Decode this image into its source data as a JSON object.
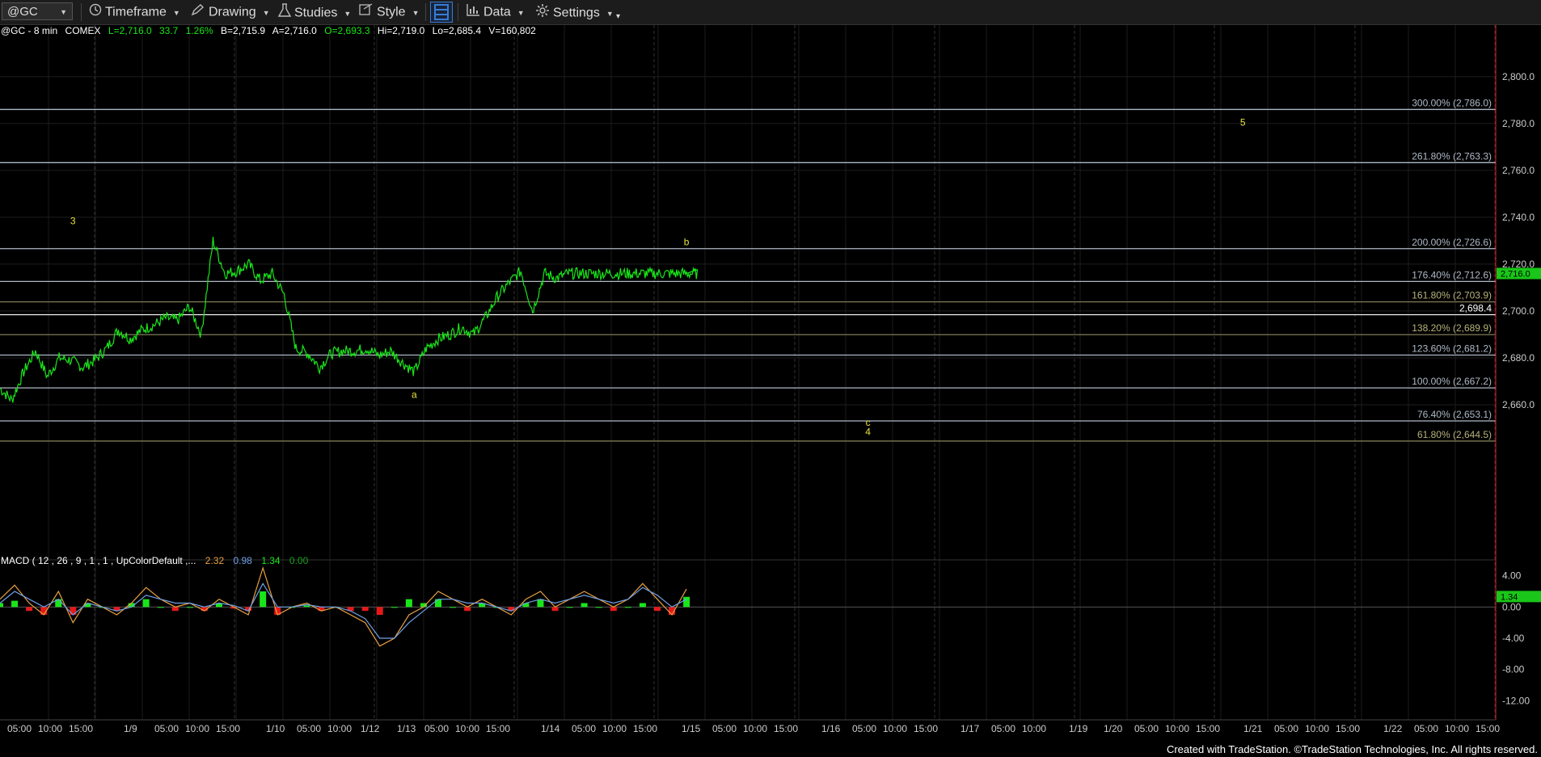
{
  "toolbar": {
    "symbol": "@GC",
    "timeframe": "Timeframe",
    "drawing": "Drawing",
    "studies": "Studies",
    "style": "Style",
    "data": "Data",
    "settings": "Settings",
    "icons": [
      "clock-icon",
      "pencil-icon",
      "flask-icon",
      "style-icon",
      "layout-icon",
      "bar-chart-icon",
      "gear-icon"
    ]
  },
  "quote_line": {
    "name": "@GC - 8 min",
    "exchange": "COMEX",
    "last": "L=2,716.0",
    "change": "33.7",
    "pct": "1.26%",
    "bid": "B=2,715.9",
    "ask": "A=2,716.0",
    "open": "O=2,693.3",
    "high": "Hi=2,719.0",
    "low": "Lo=2,685.4",
    "volume": "V=160,802"
  },
  "colors": {
    "price": "#19e619",
    "fib_line": "#aeb9c6",
    "fib_line_alt": "#7d7a55",
    "wave_label": "#e8e23c",
    "macd_line": "#e8a040",
    "signal_line": "#6fa0e8",
    "hist_pos": "#19e619",
    "hist_neg": "#e61919",
    "last_price_tag": "#19c619"
  },
  "footer": "Created with TradeStation. ©TradeStation Technologies, Inc. All rights reserved.",
  "chart_data": [
    {
      "type": "line",
      "title": "",
      "series": [
        {
          "name": "@GC - 8 min",
          "x_index": [
            0,
            3,
            6,
            9,
            12,
            15,
            18,
            21,
            24,
            27,
            30,
            33,
            36,
            39,
            42,
            45,
            48,
            51,
            54,
            57,
            60,
            63,
            66,
            69,
            72,
            75,
            78,
            81,
            84,
            87,
            90,
            93,
            96,
            99,
            102,
            105,
            108,
            111,
            114,
            117,
            120,
            123,
            126,
            129,
            132,
            135,
            138,
            141,
            144,
            147,
            150,
            153,
            156,
            159,
            162,
            165,
            168,
            171,
            174,
            177,
            180,
            183,
            186,
            189,
            192,
            195
          ],
          "values": [
            2667,
            2662,
            2674,
            2683,
            2672,
            2680,
            2679,
            2676,
            2679,
            2684,
            2692,
            2688,
            2692,
            2694,
            2697,
            2696,
            2702,
            2690,
            2730,
            2716,
            2717,
            2720,
            2713,
            2716,
            2707,
            2684,
            2682,
            2676,
            2682,
            2683,
            2683,
            2684,
            2681,
            2683,
            2678,
            2674,
            2684,
            2688,
            2690,
            2693,
            2690,
            2697,
            2706,
            2712,
            2717,
            2700,
            2716,
            2714,
            2716,
            2716,
            2716,
            2716,
            2716,
            2716,
            2716,
            2716,
            2716,
            2716,
            2716,
            2716,
            2716,
            2716,
            2716,
            2716,
            2716,
            2716
          ]
        }
      ],
      "x_tick_labels": [
        "05:00",
        "10:00",
        "15:00",
        "1/9",
        "05:00",
        "10:00",
        "15:00",
        "1/10",
        "05:00",
        "10:00",
        "1/12",
        "1/13",
        "05:00",
        "10:00",
        "15:00",
        "1/14",
        "05:00",
        "10:00",
        "15:00",
        "1/15",
        "05:00",
        "10:00",
        "15:00",
        "1/16",
        "05:00",
        "10:00",
        "15:00",
        "1/17",
        "05:00",
        "10:00",
        "1/19",
        "1/20",
        "05:00",
        "10:00",
        "15:00",
        "1/21",
        "05:00",
        "10:00",
        "15:00",
        "1/22",
        "05:00",
        "10:00",
        "15:00"
      ],
      "y_ticks": [
        "2,800.0",
        "2,780.0",
        "2,760.0",
        "2,740.0",
        "2,720.0",
        "2,700.0",
        "2,680.0",
        "2,660.0"
      ],
      "ylim": [
        2640,
        2822
      ],
      "last_price": "2,716.0",
      "price_line_value": "2,698.4",
      "fib_levels": [
        {
          "label": "300.00% (2,786.0)",
          "value": 2786.0
        },
        {
          "label": "261.80% (2,763.3)",
          "value": 2763.3
        },
        {
          "label": "200.00% (2,726.6)",
          "value": 2726.6
        },
        {
          "label": "176.40% (2,712.6)",
          "value": 2712.6
        },
        {
          "label": "161.80% (2,703.9)",
          "value": 2703.9
        },
        {
          "label": "138.20% (2,689.9)",
          "value": 2689.9
        },
        {
          "label": "123.60% (2,681.2)",
          "value": 2681.2
        },
        {
          "label": "100.00% (2,667.2)",
          "value": 2667.2
        },
        {
          "label": "76.40% (2,653.1)",
          "value": 2653.1
        },
        {
          "label": "61.80% (2,644.5)",
          "value": 2644.5
        }
      ],
      "wave_labels": [
        {
          "text": "3",
          "x_index": 18.5,
          "value": 2737
        },
        {
          "text": "b",
          "x_index": 174,
          "value": 2728
        },
        {
          "text": "a",
          "x_index": 105,
          "value": 2663
        },
        {
          "text": "5",
          "x_index": 315,
          "value": 2779
        },
        {
          "text": "c",
          "x_index": 220,
          "value": 2651
        },
        {
          "text": "4",
          "x_index": 220,
          "value": 2647
        }
      ]
    },
    {
      "type": "line",
      "title": "MACD ( 12 , 26 , 9 , 1 , 1 , UpColorDefault ,...",
      "legend_values": [
        "2.32",
        "0.98",
        "1.34",
        "0.00"
      ],
      "y_ticks": [
        "4.00",
        "0.00",
        "-4.00",
        "-8.00",
        "-12.00"
      ],
      "ylim": [
        -13,
        5
      ],
      "last_value": "1.34",
      "series": [
        {
          "name": "MACD",
          "values": [
            1,
            2.8,
            0.5,
            -1,
            2,
            -2,
            1,
            0,
            -1,
            0.5,
            2.5,
            1,
            0,
            0.5,
            -0.5,
            1,
            0,
            -1,
            5,
            -1,
            0,
            0.5,
            -0.5,
            0,
            -1,
            -2,
            -5,
            -4,
            -1,
            0,
            2,
            1,
            0,
            1,
            0,
            -1,
            1,
            2,
            0,
            1,
            2,
            1,
            0,
            1,
            3,
            1,
            -1,
            2.3
          ]
        },
        {
          "name": "Signal",
          "values": [
            0.5,
            2,
            1,
            0,
            1,
            -1,
            0.5,
            0,
            -0.5,
            0,
            1.5,
            1,
            0.5,
            0.5,
            0,
            0.5,
            0.2,
            -0.5,
            3,
            0,
            0,
            0.3,
            0,
            0,
            -0.5,
            -1.5,
            -4,
            -4,
            -2,
            -0.5,
            1,
            1,
            0.5,
            0.5,
            0,
            -0.5,
            0.5,
            1,
            0.5,
            1,
            1.5,
            1,
            0.5,
            1,
            2.5,
            1.5,
            0,
            1
          ]
        },
        {
          "name": "Histogram",
          "values": [
            0.5,
            0.8,
            -0.5,
            -1,
            1,
            -1,
            0.5,
            0,
            -0.5,
            0.5,
            1,
            0,
            -0.5,
            0,
            -0.5,
            0.5,
            -0.2,
            -0.5,
            2,
            -1,
            0,
            0.2,
            -0.5,
            0,
            -0.5,
            -0.5,
            -1,
            0,
            1,
            0.5,
            1,
            0,
            -0.5,
            0.5,
            0,
            -0.5,
            0.5,
            1,
            -0.5,
            0,
            0.5,
            0,
            -0.5,
            0,
            0.5,
            -0.5,
            -1,
            1.3
          ]
        }
      ]
    }
  ]
}
